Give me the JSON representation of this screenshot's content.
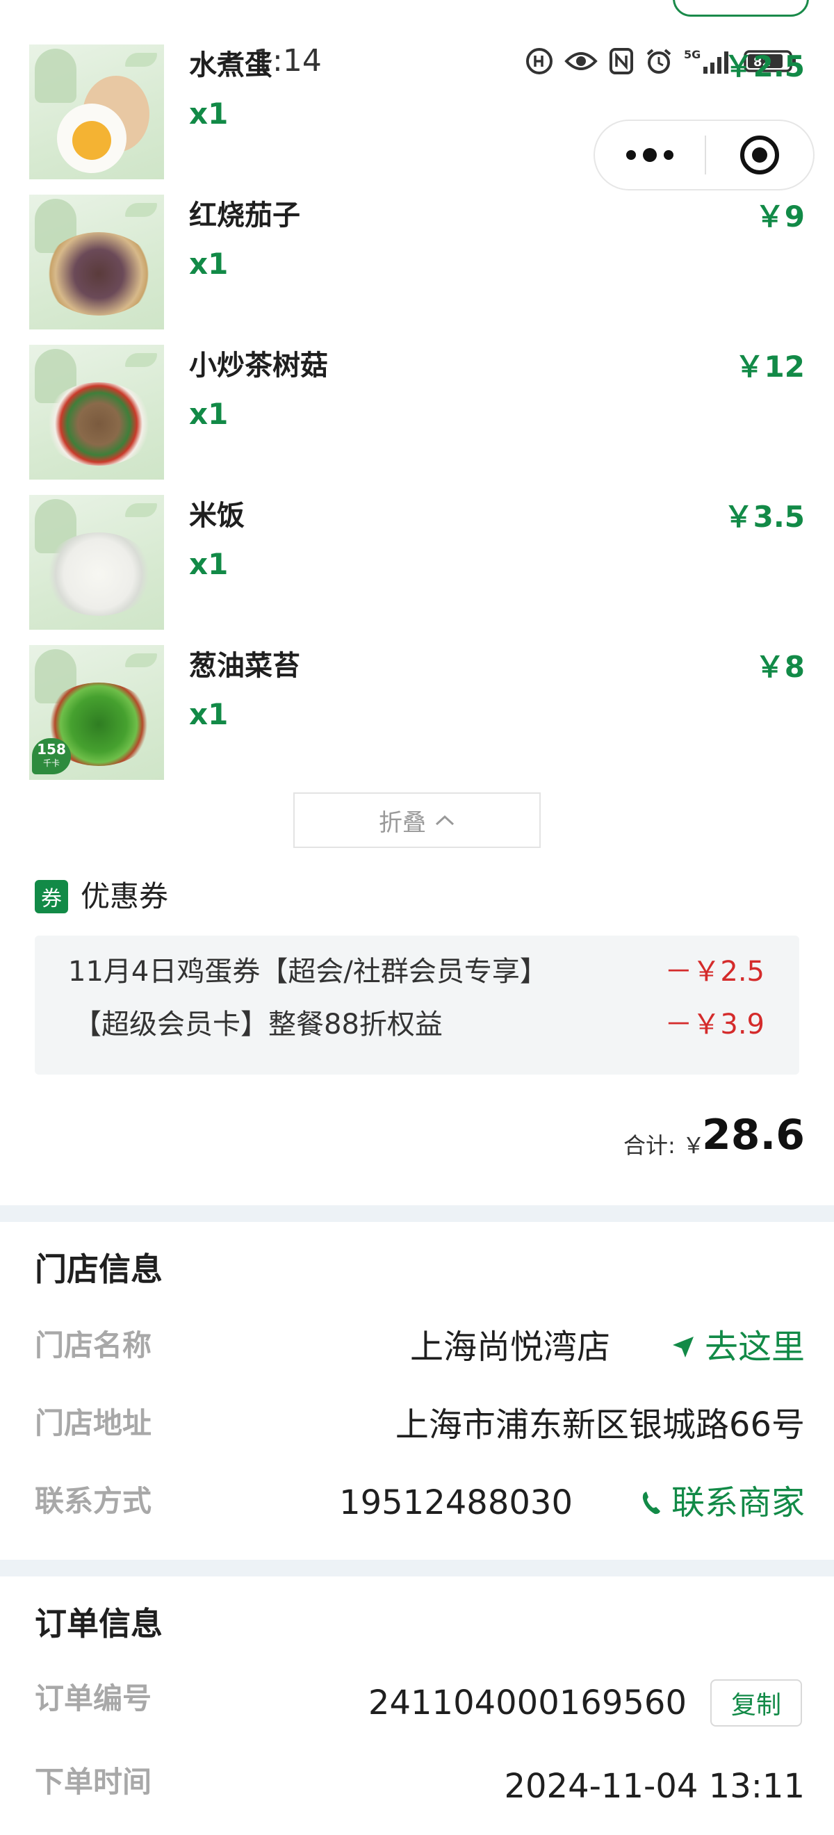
{
  "status_bar": {
    "time": "1:14",
    "icons": [
      "hd-call-icon",
      "eye-icon",
      "nfc-icon",
      "alarm-icon",
      "signal-5g-icon",
      "battery-icon"
    ],
    "battery": "82"
  },
  "capsule": {
    "more_icon": "more-dots-icon",
    "close_icon": "close-target-icon"
  },
  "items": [
    {
      "name": "水煮蛋",
      "qty": "x1",
      "price": "￥2.5",
      "image": "boiled-egg"
    },
    {
      "name": "红烧茄子",
      "qty": "x1",
      "price": "￥9",
      "image": "braised-eggplant"
    },
    {
      "name": "小炒茶树菇",
      "qty": "x1",
      "price": "￥12",
      "image": "stir-fried-tea-tree-mushroom"
    },
    {
      "name": "米饭",
      "qty": "x1",
      "price": "￥3.5",
      "image": "rice"
    },
    {
      "name": "葱油菜苔",
      "qty": "x1",
      "price": "￥8",
      "image": "scallion-oil-greens",
      "badge": "158",
      "badge_sub": "千卡"
    }
  ],
  "fold_button": {
    "label": "折叠"
  },
  "coupons": {
    "badge": "券",
    "title": "优惠券",
    "rows": [
      {
        "name": "11月4日鸡蛋券【超会/社群会员专享】",
        "amount": "－￥2.5"
      },
      {
        "name": "【超级会员卡】整餐88折权益",
        "amount": "－￥3.9"
      }
    ]
  },
  "total": {
    "label": "合计: ￥",
    "value": "28.6"
  },
  "store": {
    "title": "门店信息",
    "name_label": "门店名称",
    "name": "上海尚悦湾店",
    "navigate": "去这里",
    "address_label": "门店地址",
    "address": "上海市浦东新区银城路66号",
    "contact_label": "联系方式",
    "phone": "19512488030",
    "contact_action": "联系商家"
  },
  "order": {
    "title": "订单信息",
    "number_label": "订单编号",
    "number": "241104000169560",
    "copy": "复制",
    "time_label": "下单时间",
    "time": "2024-11-04 13:11"
  },
  "colors": {
    "accent_green": "#128a47",
    "discount_red": "#d42b2b",
    "separator": "#edf2f6"
  }
}
